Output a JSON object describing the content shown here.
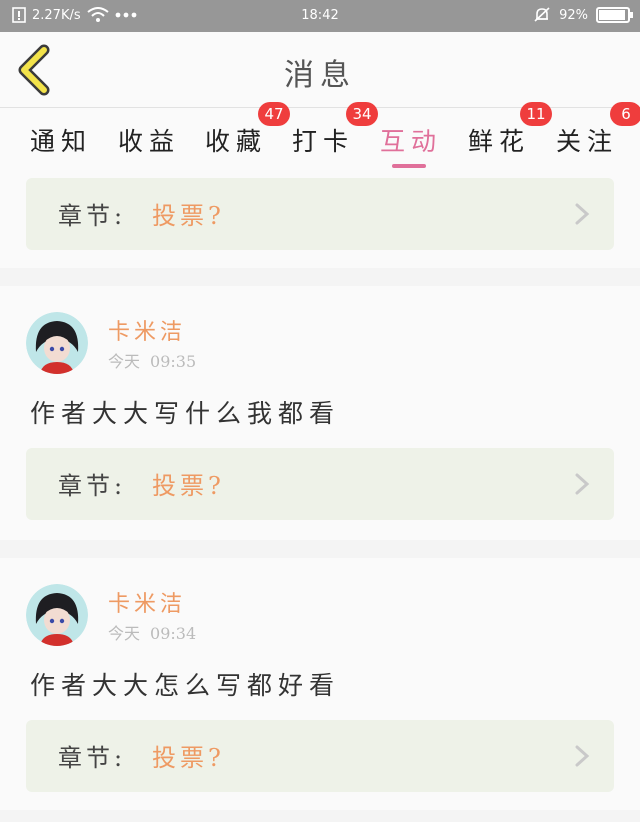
{
  "status_bar": {
    "speed": "2.27K/s",
    "time": "18:42",
    "battery": "92%",
    "battery_level": 0.92
  },
  "header": {
    "title": "消息"
  },
  "tabs": [
    {
      "label": "通知",
      "badge": ""
    },
    {
      "label": "收益",
      "badge": ""
    },
    {
      "label": "收藏",
      "badge": "47"
    },
    {
      "label": "打卡",
      "badge": "34"
    },
    {
      "label": "互动",
      "badge": "",
      "active": true
    },
    {
      "label": "鲜花",
      "badge": "11"
    },
    {
      "label": "关注",
      "badge": "6"
    }
  ],
  "cards": [
    {
      "chapter_label": "章节:",
      "chapter_value": "投票?"
    },
    {
      "user": "卡米洁",
      "day": "今天",
      "time": "09:35",
      "comment": "作者大大写什么我都看",
      "chapter_label": "章节:",
      "chapter_value": "投票?"
    },
    {
      "user": "卡米洁",
      "day": "今天",
      "time": "09:34",
      "comment": "作者大大怎么写都好看",
      "chapter_label": "章节:",
      "chapter_value": "投票?"
    }
  ],
  "colors": {
    "accent": "#e0709a",
    "orange": "#ee9a63",
    "badge": "#ef3d3d",
    "chapter_bg": "#eef2e8"
  }
}
